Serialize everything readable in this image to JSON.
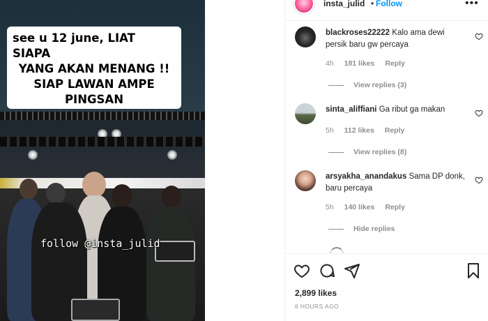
{
  "video": {
    "caption_lines": [
      "see u 12 june, LIAT SIAPA",
      "YANG AKAN MENANG !!",
      "SIAP LAWAN AMPE",
      "PINGSAN"
    ],
    "watermark": "follow @insta_julid"
  },
  "header": {
    "username": "insta_julid",
    "separator": "•",
    "follow_label": "Follow",
    "more_icon": "more-horizontal-icon"
  },
  "comments": [
    {
      "username": "blackroses22222",
      "text": "Kalo ama dewi persik baru gw percaya",
      "age": "4h",
      "likes": "181 likes",
      "reply_label": "Reply",
      "replies_label": "View replies (3)"
    },
    {
      "username": "sinta_aliffiani",
      "text": "Ga ribut ga makan",
      "age": "5h",
      "likes": "112 likes",
      "reply_label": "Reply",
      "replies_label": "View replies (8)"
    },
    {
      "username": "arsyakha_anandakus",
      "text": "Sama DP donk, baru percaya",
      "age": "5h",
      "likes": "140 likes",
      "reply_label": "Reply",
      "replies_label": "Hide replies"
    }
  ],
  "actions": {
    "icons": [
      "heart-icon",
      "comment-icon",
      "share-icon",
      "bookmark-icon"
    ],
    "likes": "2,899 likes",
    "timestamp": "6 HOURS AGO"
  },
  "colors": {
    "link_blue": "#0095f6",
    "text": "#262626",
    "muted": "#8e8e8e",
    "divider": "#efefef"
  }
}
